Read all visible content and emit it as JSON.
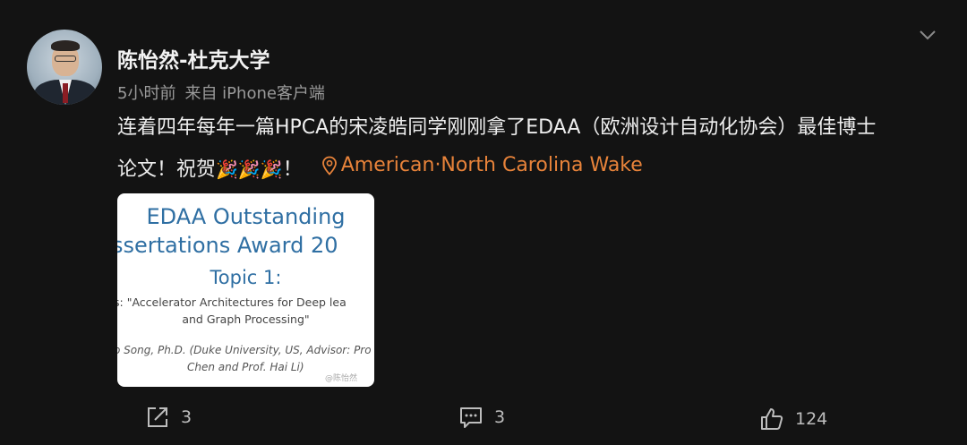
{
  "post": {
    "author": "陈怡然-杜克大学",
    "time": "5小时前",
    "source": "来自 iPhone客户端",
    "text_line1": "连着四年每年一篇HPCA的宋凌皓同学刚刚拿了EDAA（欧洲设计自动化协会）最佳博士",
    "text_line2": "论文！祝贺",
    "emoji": "🎉🎉🎉",
    "text_end": "！",
    "location": "American·North Carolina Wake"
  },
  "image_card": {
    "line1": "EDAA Outstanding",
    "line2": "ssertations Award 20",
    "line3": "Topic 1:",
    "line4": "s: \"Accelerator Architectures for Deep lea",
    "line5": "and Graph Processing\"",
    "line6": "o Song, Ph.D. (Duke University, US, Advisor: Pro",
    "line7": "Chen and Prof. Hai Li)",
    "watermark": "@陈怡然"
  },
  "actions": {
    "repost_count": "3",
    "comment_count": "3",
    "like_count": "124"
  },
  "icons": {
    "menu": "chevron-down-icon",
    "location": "location-pin-icon",
    "repost": "share-icon",
    "comment": "comment-icon",
    "like": "thumbs-up-icon"
  },
  "colors": {
    "background": "#131313",
    "location_accent": "#e8833a",
    "card_title": "#2f6fa3"
  }
}
